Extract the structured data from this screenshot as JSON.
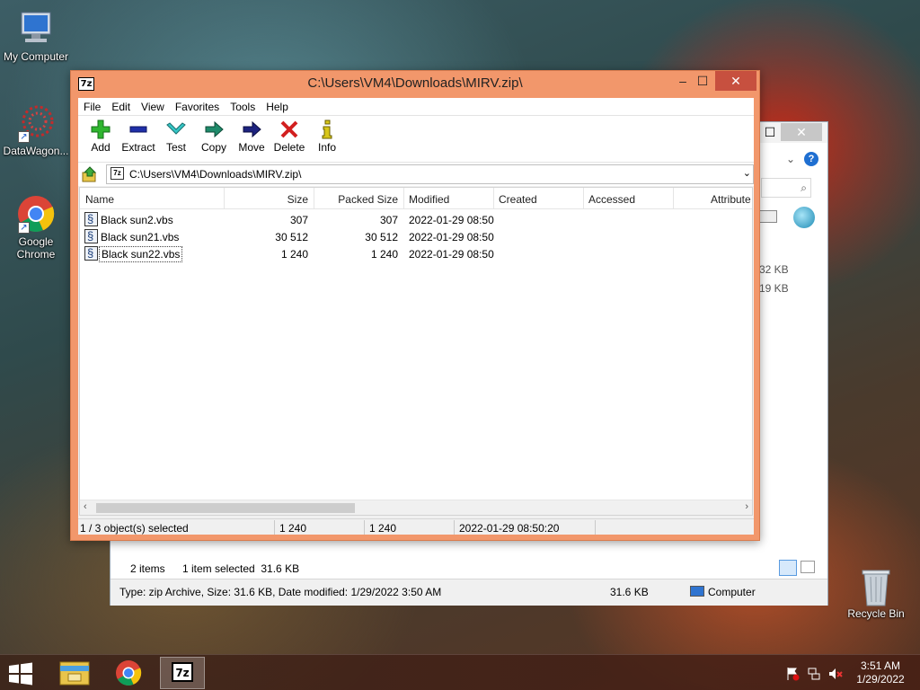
{
  "desktop": {
    "icons": [
      {
        "label": "My Computer"
      },
      {
        "label": "DataWagon..."
      },
      {
        "label": "Google Chrome"
      },
      {
        "label": "Recycle Bin"
      }
    ]
  },
  "explorer_bg": {
    "size_col": [
      "32 KB",
      "19 KB"
    ],
    "items_count": "2 items",
    "selected_info": "1 item selected  31.6 KB",
    "details": "Type: zip Archive, Size: 31.6 KB, Date modified: 1/29/2022 3:50 AM",
    "details_size": "31.6 KB",
    "location": "Computer"
  },
  "zip": {
    "title": "C:\\Users\\VM4\\Downloads\\MIRV.zip\\",
    "app_icon": "7z",
    "window_controls": {
      "minimize": "–",
      "maximize": "☐",
      "close": "✕"
    },
    "menu": [
      "File",
      "Edit",
      "View",
      "Favorites",
      "Tools",
      "Help"
    ],
    "toolbar": [
      {
        "label": "Add",
        "icon": "add-icon",
        "color": "#2fb52f"
      },
      {
        "label": "Extract",
        "icon": "extract-icon",
        "color": "#1f2fa8"
      },
      {
        "label": "Test",
        "icon": "test-icon",
        "color": "#35c6c6"
      },
      {
        "label": "Copy",
        "icon": "copy-icon",
        "color": "#1e8a6a"
      },
      {
        "label": "Move",
        "icon": "move-icon",
        "color": "#1d237f"
      },
      {
        "label": "Delete",
        "icon": "delete-icon",
        "color": "#d21f1f"
      },
      {
        "label": "Info",
        "icon": "info-icon",
        "color": "#d8c71a"
      }
    ],
    "address": "C:\\Users\\VM4\\Downloads\\MIRV.zip\\",
    "columns": [
      "Name",
      "Size",
      "Packed Size",
      "Modified",
      "Created",
      "Accessed",
      "Attribute"
    ],
    "files": [
      {
        "name": "Black sun2.vbs",
        "size": "307",
        "packed": "307",
        "modified": "2022-01-29 08:50"
      },
      {
        "name": "Black sun21.vbs",
        "size": "30 512",
        "packed": "30 512",
        "modified": "2022-01-29 08:50"
      },
      {
        "name": "Black sun22.vbs",
        "size": "1 240",
        "packed": "1 240",
        "modified": "2022-01-29 08:50"
      }
    ],
    "status": {
      "selection": "1 / 3 object(s) selected",
      "size": "1 240",
      "packed": "1 240",
      "modified": "2022-01-29 08:50:20"
    }
  },
  "taskbar": {
    "time": "3:51 AM",
    "date": "1/29/2022"
  }
}
